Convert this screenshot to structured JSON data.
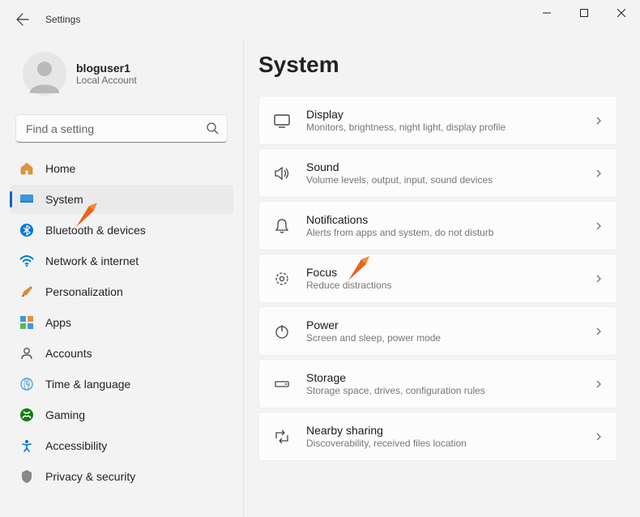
{
  "window": {
    "title": "Settings"
  },
  "user": {
    "name": "bloguser1",
    "account_type": "Local Account"
  },
  "search": {
    "placeholder": "Find a setting"
  },
  "nav": {
    "items": [
      {
        "label": "Home"
      },
      {
        "label": "System"
      },
      {
        "label": "Bluetooth & devices"
      },
      {
        "label": "Network & internet"
      },
      {
        "label": "Personalization"
      },
      {
        "label": "Apps"
      },
      {
        "label": "Accounts"
      },
      {
        "label": "Time & language"
      },
      {
        "label": "Gaming"
      },
      {
        "label": "Accessibility"
      },
      {
        "label": "Privacy & security"
      }
    ],
    "selected_index": 1
  },
  "main": {
    "title": "System",
    "items": [
      {
        "label": "Display",
        "desc": "Monitors, brightness, night light, display profile"
      },
      {
        "label": "Sound",
        "desc": "Volume levels, output, input, sound devices"
      },
      {
        "label": "Notifications",
        "desc": "Alerts from apps and system, do not disturb"
      },
      {
        "label": "Focus",
        "desc": "Reduce distractions"
      },
      {
        "label": "Power",
        "desc": "Screen and sleep, power mode"
      },
      {
        "label": "Storage",
        "desc": "Storage space, drives, configuration rules"
      },
      {
        "label": "Nearby sharing",
        "desc": "Discoverability, received files location"
      }
    ]
  },
  "colors": {
    "accent": "#0067c0"
  }
}
